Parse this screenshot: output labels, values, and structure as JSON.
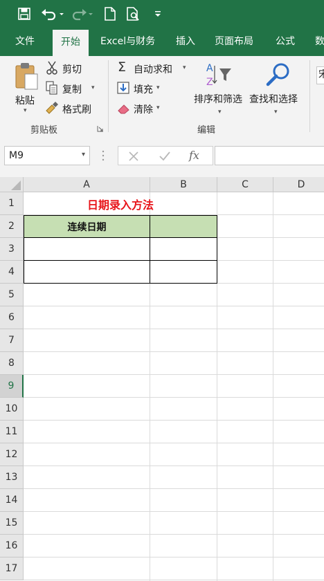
{
  "colors": {
    "brand": "#217346",
    "ribbon_bg": "#f3f3f3",
    "title_red": "#e8141a",
    "header_fill": "#c6dfb3"
  },
  "qat": {
    "icons": [
      "save-icon",
      "undo-icon",
      "redo-icon",
      "new-file-icon",
      "print-preview-icon",
      "customize-qat-icon"
    ]
  },
  "tabs": [
    {
      "label": "文件",
      "active": false
    },
    {
      "label": "开始",
      "active": true
    },
    {
      "label": "Excel与财务",
      "active": false
    },
    {
      "label": "插入",
      "active": false
    },
    {
      "label": "页面布局",
      "active": false
    },
    {
      "label": "公式",
      "active": false
    },
    {
      "label": "数",
      "active": false
    }
  ],
  "ribbon": {
    "clipboard": {
      "paste": "粘贴",
      "cut": "剪切",
      "copy": "复制",
      "format_painter": "格式刷",
      "group_label": "剪贴板"
    },
    "editing": {
      "autosum": "自动求和",
      "fill": "填充",
      "clear": "清除",
      "sort_filter": "排序和筛选",
      "find_select": "查找和选择",
      "group_label": "编辑"
    },
    "font_box_partial": "宋"
  },
  "formula_bar": {
    "name_box": "M9",
    "formula": "",
    "fx": "fx"
  },
  "sheet": {
    "columns": [
      "A",
      "B",
      "C",
      "D"
    ],
    "rows": [
      "1",
      "2",
      "3",
      "4",
      "5",
      "6",
      "7",
      "8",
      "9",
      "10",
      "11",
      "12",
      "13",
      "14",
      "15",
      "16",
      "17"
    ],
    "selected_row": "9",
    "cells": {
      "A1": "日期录入方法",
      "A2": "连续日期",
      "B2": ""
    }
  }
}
